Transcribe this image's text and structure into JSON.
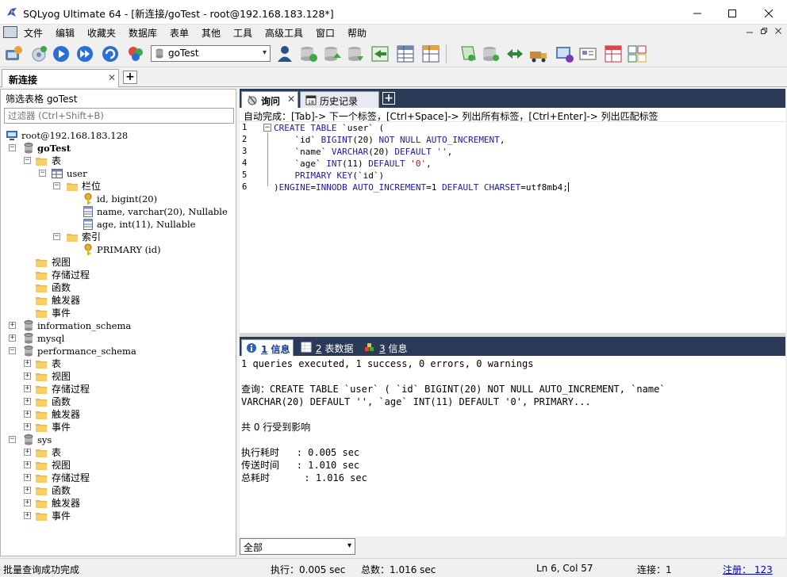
{
  "window": {
    "title": "SQLyog Ultimate 64 - [新连接/goTest - root@192.168.183.128*]",
    "min_icon": "minimize-icon",
    "max_icon": "maximize-icon",
    "close_icon": "close-icon"
  },
  "menu": {
    "items": [
      "文件",
      "编辑",
      "收藏夹",
      "数据库",
      "表单",
      "其他",
      "工具",
      "高级工具",
      "窗口",
      "帮助"
    ]
  },
  "toolbar": {
    "db_select": "goTest",
    "arrow": "▾"
  },
  "connection_tab": {
    "label": "新连接",
    "close": "✕",
    "add": "+"
  },
  "object_browser": {
    "filter_label": "筛选表格 goTest",
    "filter_placeholder": "过滤器 (Ctrl+Shift+B)",
    "tree": [
      {
        "label": "root@192.168.183.128"
      },
      {
        "label": "goTest"
      },
      {
        "label": "表"
      },
      {
        "label": "user"
      },
      {
        "label": "栏位"
      },
      {
        "label": "id, bigint(20)"
      },
      {
        "label": "name, varchar(20), Nullable"
      },
      {
        "label": "age, int(11), Nullable"
      },
      {
        "label": "索引"
      },
      {
        "label": "PRIMARY (id)"
      },
      {
        "label": "视图"
      },
      {
        "label": "存储过程"
      },
      {
        "label": "函数"
      },
      {
        "label": "触发器"
      },
      {
        "label": "事件"
      },
      {
        "label": "information_schema"
      },
      {
        "label": "mysql"
      },
      {
        "label": "performance_schema"
      },
      {
        "label": "表"
      },
      {
        "label": "视图"
      },
      {
        "label": "存储过程"
      },
      {
        "label": "函数"
      },
      {
        "label": "触发器"
      },
      {
        "label": "事件"
      },
      {
        "label": "sys"
      },
      {
        "label": "表"
      },
      {
        "label": "视图"
      },
      {
        "label": "存储过程"
      },
      {
        "label": "函数"
      },
      {
        "label": "触发器"
      },
      {
        "label": "事件"
      }
    ]
  },
  "query_tabs": {
    "query": "询问",
    "history": "历史记录",
    "close": "✕",
    "add": "+"
  },
  "autocomplete_hint": "自动完成：[Tab]-> 下一个标签，[Ctrl+Space]-> 列出所有标签，[Ctrl+Enter]-> 列出匹配标签",
  "editor": {
    "line_numbers": [
      "1",
      "2",
      "3",
      "4",
      "5",
      "6"
    ],
    "fold_open": "−"
  },
  "result_tabs": {
    "info_num": "1",
    "info": "信息",
    "data_num": "2",
    "data": "表数据",
    "info2_num": "3",
    "info2": "信息"
  },
  "results": {
    "summary": "1 queries executed, 1 success, 0 errors, 0 warnings",
    "query_label": "查询：",
    "query_line1": "CREATE TABLE `user` ( `id` BIGINT(20) NOT NULL AUTO_INCREMENT, `name`",
    "query_line2": "VARCHAR(20) DEFAULT '', `age` INT(11) DEFAULT '0', PRIMARY...",
    "affected": "共 0 行受到影响",
    "exec_label": "执行耗时",
    "exec_value": "   : 0.005 sec",
    "transfer_label": "传送时间",
    "transfer_value": "   : 1.010 sec",
    "total_label": "总耗时",
    "total_value": "      : 1.016 sec",
    "filter_select": "全部"
  },
  "status": {
    "message": "批量查询成功完成",
    "exec": "执行：0.005 sec",
    "total": "总数：1.016 sec",
    "position": "Ln 6, Col 57",
    "connections": "连接：1",
    "register": "注册： 123"
  }
}
